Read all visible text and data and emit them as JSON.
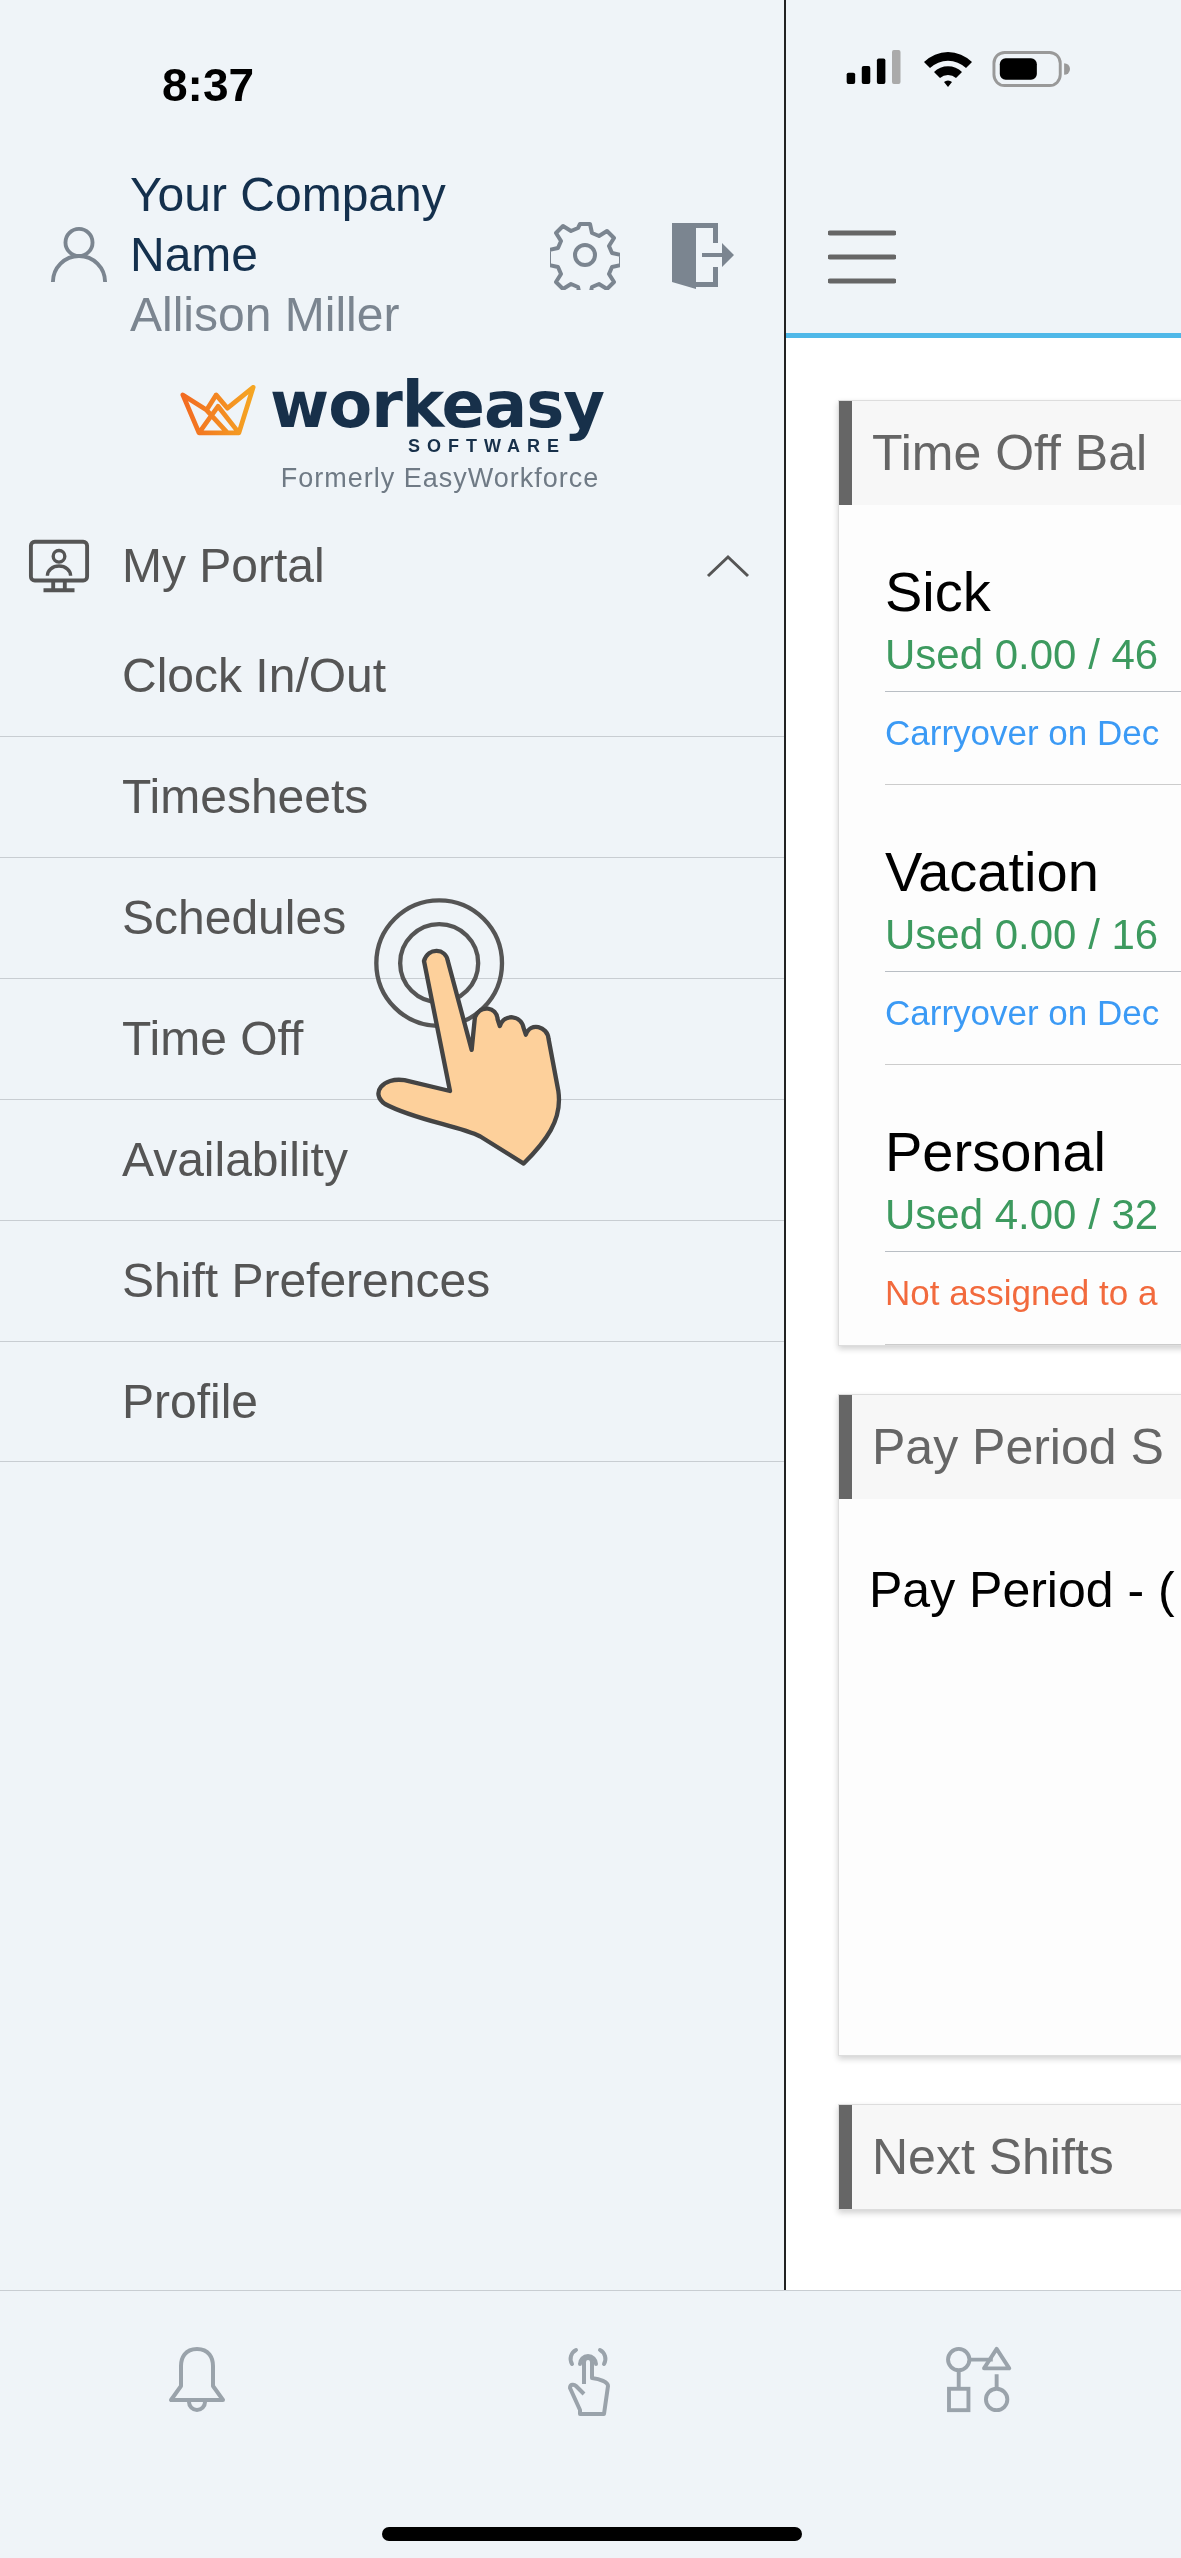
{
  "status_bar": {
    "time": "8:37"
  },
  "drawer": {
    "company": "Your Company Name",
    "user": "Allison Miller",
    "logo": {
      "wordmark": "workeasy",
      "subtitle": "SOFTWARE",
      "tagline": "Formerly EasyWorkforce"
    },
    "section": {
      "label": "My Portal",
      "expanded": true,
      "items": [
        {
          "label": "Clock In/Out"
        },
        {
          "label": "Timesheets"
        },
        {
          "label": "Schedules"
        },
        {
          "label": "Time Off"
        },
        {
          "label": "Availability"
        },
        {
          "label": "Shift Preferences"
        },
        {
          "label": "Profile"
        }
      ]
    }
  },
  "cards": [
    {
      "title": "Time Off Bal",
      "kind": "balances",
      "items": [
        {
          "name": "Sick",
          "used": "Used 0.00 / 46",
          "note": "Carryover on Dec",
          "color": "#3b9af5"
        },
        {
          "name": "Vacation",
          "used": "Used 0.00 / 16",
          "note": "Carryover on Dec",
          "color": "#3b9af5"
        },
        {
          "name": "Personal",
          "used": "Used 4.00 / 32",
          "note": "Not assigned to a",
          "color": "#f26a3d"
        }
      ]
    },
    {
      "title": "Pay Period S",
      "kind": "text",
      "text": "Pay Period - ("
    },
    {
      "title": "Next Shifts",
      "kind": "empty"
    }
  ]
}
